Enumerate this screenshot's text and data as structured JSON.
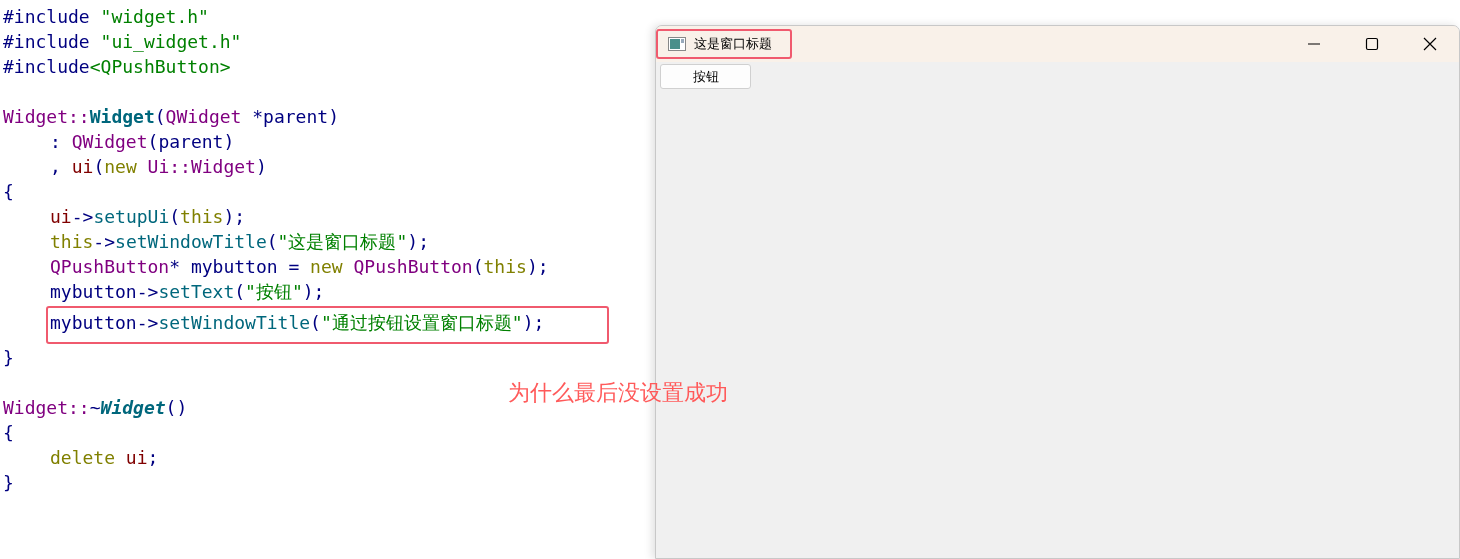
{
  "code_lines": [
    {
      "indented": false,
      "highlighted": false,
      "tokens": [
        {
          "kind": "plain",
          "text": "#include "
        },
        {
          "kind": "string",
          "text": "\"widget.h\""
        }
      ]
    },
    {
      "indented": false,
      "highlighted": false,
      "tokens": [
        {
          "kind": "plain",
          "text": "#include "
        },
        {
          "kind": "string",
          "text": "\"ui_widget.h\""
        }
      ]
    },
    {
      "indented": false,
      "highlighted": false,
      "tokens": [
        {
          "kind": "plain",
          "text": "#include"
        },
        {
          "kind": "string",
          "text": "<QPushButton>"
        }
      ]
    },
    {
      "gap_before": true,
      "indented": false,
      "highlighted": false,
      "tokens": [
        {
          "kind": "type",
          "text": "Widget::"
        },
        {
          "kind": "funcdef",
          "text": "Widget"
        },
        {
          "kind": "plain",
          "text": "("
        },
        {
          "kind": "type",
          "text": "QWidget"
        },
        {
          "kind": "plain",
          "text": " *parent)"
        }
      ]
    },
    {
      "indented": true,
      "highlighted": false,
      "tokens": [
        {
          "kind": "plain",
          "text": ": "
        },
        {
          "kind": "type",
          "text": "QWidget"
        },
        {
          "kind": "plain",
          "text": "(parent)"
        }
      ]
    },
    {
      "indented": true,
      "highlighted": false,
      "tokens": [
        {
          "kind": "plain",
          "text": ", "
        },
        {
          "kind": "member",
          "text": "ui"
        },
        {
          "kind": "plain",
          "text": "("
        },
        {
          "kind": "keyword",
          "text": "new"
        },
        {
          "kind": "type",
          "text": " Ui::Widget"
        },
        {
          "kind": "plain",
          "text": ")"
        }
      ]
    },
    {
      "indented": false,
      "highlighted": false,
      "tokens": [
        {
          "kind": "plain",
          "text": "{"
        }
      ]
    },
    {
      "indented": true,
      "highlighted": false,
      "tokens": [
        {
          "kind": "member",
          "text": "ui"
        },
        {
          "kind": "plain",
          "text": "->"
        },
        {
          "kind": "func",
          "text": "setupUi"
        },
        {
          "kind": "plain",
          "text": "("
        },
        {
          "kind": "keyword",
          "text": "this"
        },
        {
          "kind": "plain",
          "text": ");"
        }
      ]
    },
    {
      "indented": true,
      "highlighted": false,
      "tokens": [
        {
          "kind": "keyword",
          "text": "this"
        },
        {
          "kind": "plain",
          "text": "->"
        },
        {
          "kind": "func",
          "text": "setWindowTitle"
        },
        {
          "kind": "plain",
          "text": "("
        },
        {
          "kind": "string",
          "text": "\"这是窗口标题\""
        },
        {
          "kind": "plain",
          "text": ");"
        }
      ]
    },
    {
      "indented": true,
      "highlighted": false,
      "tokens": [
        {
          "kind": "type",
          "text": "QPushButton"
        },
        {
          "kind": "plain",
          "text": "* mybutton = "
        },
        {
          "kind": "keyword",
          "text": "new"
        },
        {
          "kind": "type",
          "text": " QPushButton"
        },
        {
          "kind": "plain",
          "text": "("
        },
        {
          "kind": "keyword",
          "text": "this"
        },
        {
          "kind": "plain",
          "text": ");"
        }
      ]
    },
    {
      "indented": true,
      "highlighted": false,
      "tokens": [
        {
          "kind": "plain",
          "text": "mybutton->"
        },
        {
          "kind": "func",
          "text": "setText"
        },
        {
          "kind": "plain",
          "text": "("
        },
        {
          "kind": "string",
          "text": "\"按钮\""
        },
        {
          "kind": "plain",
          "text": ");"
        }
      ]
    },
    {
      "indented": true,
      "highlighted": true,
      "tokens": [
        {
          "kind": "plain",
          "text": "mybutton->"
        },
        {
          "kind": "func",
          "text": "setWindowTitle"
        },
        {
          "kind": "plain",
          "text": "("
        },
        {
          "kind": "string",
          "text": "\"通过按钮设置窗口标题\""
        },
        {
          "kind": "plain",
          "text": ");"
        }
      ]
    },
    {
      "indented": false,
      "highlighted": false,
      "tokens": [
        {
          "kind": "plain",
          "text": "}"
        }
      ]
    },
    {
      "gap_before": true,
      "indented": false,
      "highlighted": false,
      "tokens": [
        {
          "kind": "type",
          "text": "Widget::"
        },
        {
          "kind": "plain",
          "text": "~"
        },
        {
          "kind": "dtor",
          "text": "Widget"
        },
        {
          "kind": "plain",
          "text": "()"
        }
      ]
    },
    {
      "indented": false,
      "highlighted": false,
      "tokens": [
        {
          "kind": "plain",
          "text": "{"
        }
      ]
    },
    {
      "indented": true,
      "highlighted": false,
      "tokens": [
        {
          "kind": "keyword",
          "text": "delete"
        },
        {
          "kind": "member",
          "text": " ui"
        },
        {
          "kind": "plain",
          "text": ";"
        }
      ]
    },
    {
      "indented": false,
      "highlighted": false,
      "tokens": [
        {
          "kind": "plain",
          "text": "}"
        }
      ]
    }
  ],
  "note": "为什么最后没设置成功",
  "window": {
    "title": "这是窗口标题",
    "title_highlighted": true,
    "button": "按钮"
  }
}
